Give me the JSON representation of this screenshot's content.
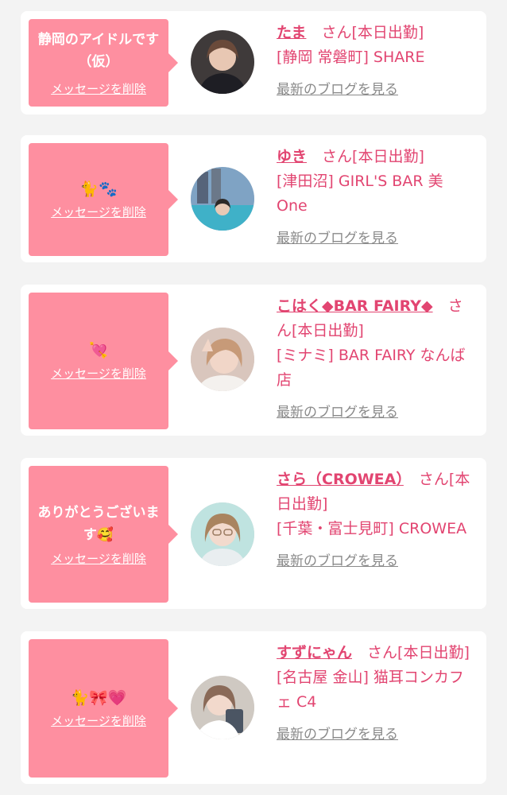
{
  "messages": [
    {
      "bubble_text": "静岡のアイドルです（仮）",
      "delete_label": "メッセージを削除",
      "name": "たま",
      "san": "さん",
      "status": "[本日出勤]",
      "shop": "[静岡 常磐町] SHARE",
      "blog_label": "最新のブログを見る"
    },
    {
      "bubble_text": "🐈🐾",
      "delete_label": "メッセージを削除",
      "name": "ゆき",
      "san": "さん",
      "status": "[本日出勤]",
      "shop": "[津田沼] GIRL'S BAR 美One",
      "blog_label": "最新のブログを見る"
    },
    {
      "bubble_text": "💘",
      "delete_label": "メッセージを削除",
      "name": "こはく◆BAR FAIRY◆",
      "san": "さん",
      "status": "[本日出勤]",
      "shop": "[ミナミ] BAR FAIRY なんば店",
      "blog_label": "最新のブログを見る"
    },
    {
      "bubble_text": "ありがとうございます🥰",
      "delete_label": "メッセージを削除",
      "name": "さら（CROWEA）",
      "san": "さん",
      "status": "[本日出勤]",
      "shop": "[千葉・富士見町] CROWEA",
      "blog_label": "最新のブログを見る"
    },
    {
      "bubble_text": "🐈🎀💗",
      "delete_label": "メッセージを削除",
      "name": "すずにゃん",
      "san": "さん",
      "status": "[本日出勤]",
      "shop": "[名古屋 金山] 猫耳コンカフェ C4",
      "blog_label": "最新のブログを見る"
    }
  ]
}
